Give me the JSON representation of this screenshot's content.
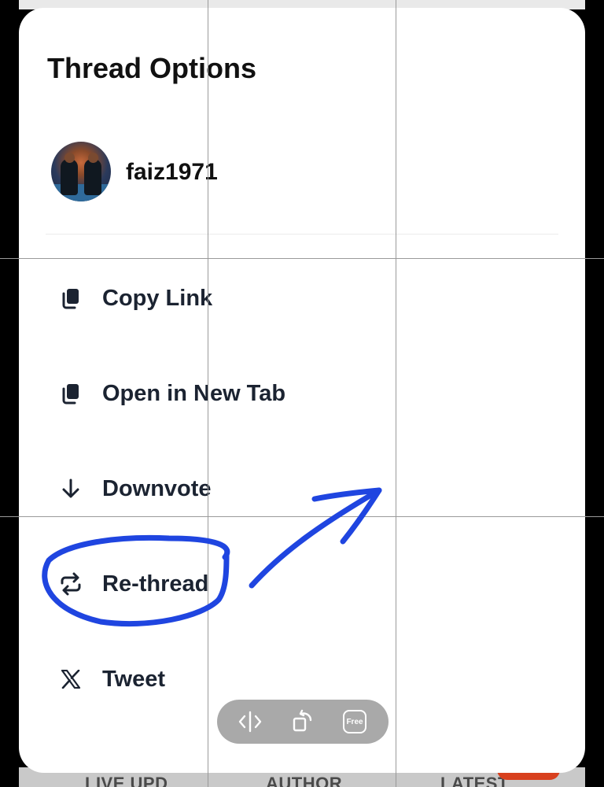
{
  "sheet": {
    "title": "Thread Options",
    "user": {
      "name": "faiz1971"
    }
  },
  "menu": {
    "items": [
      {
        "label": "Copy Link",
        "icon": "copy-icon"
      },
      {
        "label": "Open in New Tab",
        "icon": "copy-icon"
      },
      {
        "label": "Downvote",
        "icon": "arrow-down-icon"
      },
      {
        "label": "Re-thread",
        "icon": "repost-icon"
      },
      {
        "label": "Tweet",
        "icon": "x-logo-icon"
      }
    ]
  },
  "toolbar": {
    "buttons": [
      {
        "icon": "split-view-icon"
      },
      {
        "icon": "rotate-icon"
      },
      {
        "label": "Free",
        "icon": "free-crop-icon"
      }
    ]
  },
  "background_tabs": [
    "LIVE UPD",
    "AUTHOR",
    "LATEST"
  ],
  "colors": {
    "annotation": "#1f45e0",
    "text": "#1b2331",
    "toolbar": "#a9a9a9",
    "accent_red": "#d8401e"
  }
}
